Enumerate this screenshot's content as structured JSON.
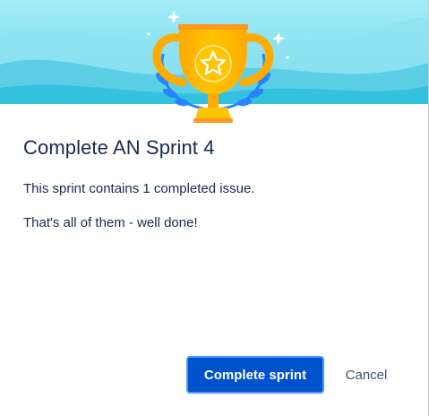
{
  "dialog": {
    "title": "Complete AN Sprint 4",
    "message_line1": "This sprint contains 1 completed issue.",
    "message_line2": "That's all of them - well done!",
    "primary_button_label": "Complete sprint",
    "cancel_button_label": "Cancel"
  },
  "icons": {
    "illustration": "trophy-icon",
    "trophy_emblem": "star-icon",
    "decoration": "sparkle-icon"
  },
  "colors": {
    "header_background": "#8fe3f2",
    "trophy_gold": "#ffc400",
    "trophy_orange": "#ff991f",
    "laurel_blue": "#2684ff",
    "title_text": "#172b4d",
    "primary_button": "#0052cc",
    "primary_button_focus_ring": "#4c9aff",
    "cancel_text": "#42526e"
  }
}
